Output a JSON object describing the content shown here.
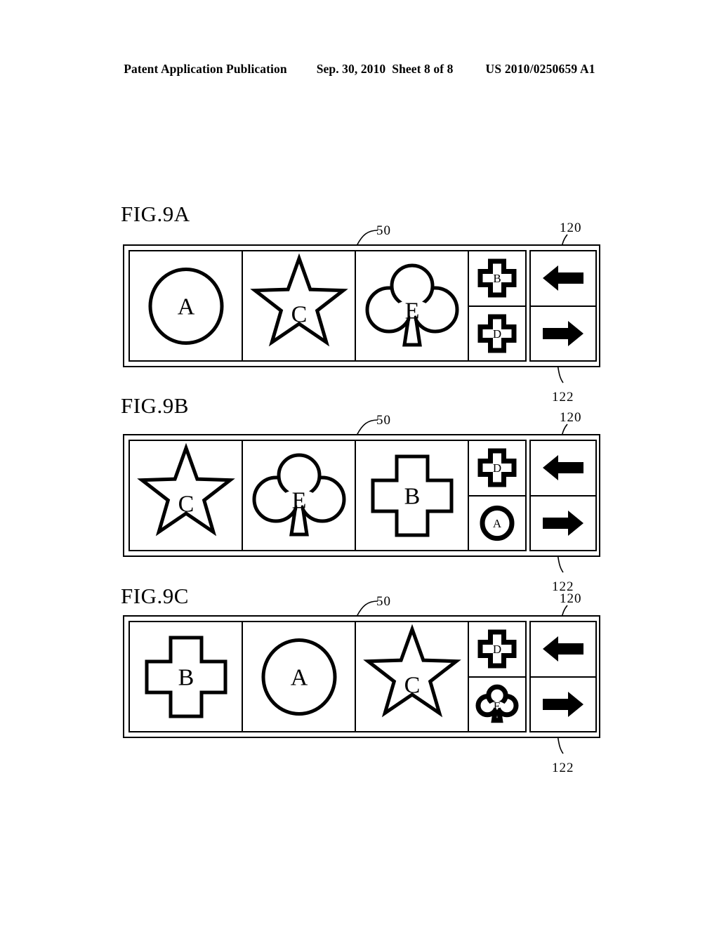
{
  "header": {
    "publication": "Patent Application Publication",
    "date": "Sep. 30, 2010",
    "sheet": "Sheet 8 of 8",
    "patent_number": "US 2010/0250659 A1"
  },
  "reference_numerals": {
    "device": "50",
    "arrow_left": "120",
    "arrow_right": "122"
  },
  "figures": [
    {
      "label": "FIG.9A",
      "slots": [
        {
          "shape": "circle",
          "letter": "A"
        },
        {
          "shape": "star",
          "letter": "C"
        },
        {
          "shape": "club",
          "letter": "E"
        }
      ],
      "mini_cells": [
        {
          "shape": "cross",
          "letter": "B"
        },
        {
          "shape": "cross",
          "letter": "D"
        }
      ],
      "arrows": [
        {
          "icon": "arrow-left-icon"
        },
        {
          "icon": "arrow-right-icon"
        }
      ]
    },
    {
      "label": "FIG.9B",
      "slots": [
        {
          "shape": "star",
          "letter": "C"
        },
        {
          "shape": "club",
          "letter": "E"
        },
        {
          "shape": "cross",
          "letter": "B"
        }
      ],
      "mini_cells": [
        {
          "shape": "cross",
          "letter": "D"
        },
        {
          "shape": "circle",
          "letter": "A"
        }
      ],
      "arrows": [
        {
          "icon": "arrow-left-icon"
        },
        {
          "icon": "arrow-right-icon"
        }
      ]
    },
    {
      "label": "FIG.9C",
      "slots": [
        {
          "shape": "cross",
          "letter": "B"
        },
        {
          "shape": "circle",
          "letter": "A"
        },
        {
          "shape": "star",
          "letter": "C"
        }
      ],
      "mini_cells": [
        {
          "shape": "cross",
          "letter": "D"
        },
        {
          "shape": "club",
          "letter": "E"
        }
      ],
      "arrows": [
        {
          "icon": "arrow-left-icon"
        },
        {
          "icon": "arrow-right-icon"
        }
      ]
    }
  ],
  "colors": {
    "ink": "#000000",
    "paper": "#ffffff"
  }
}
